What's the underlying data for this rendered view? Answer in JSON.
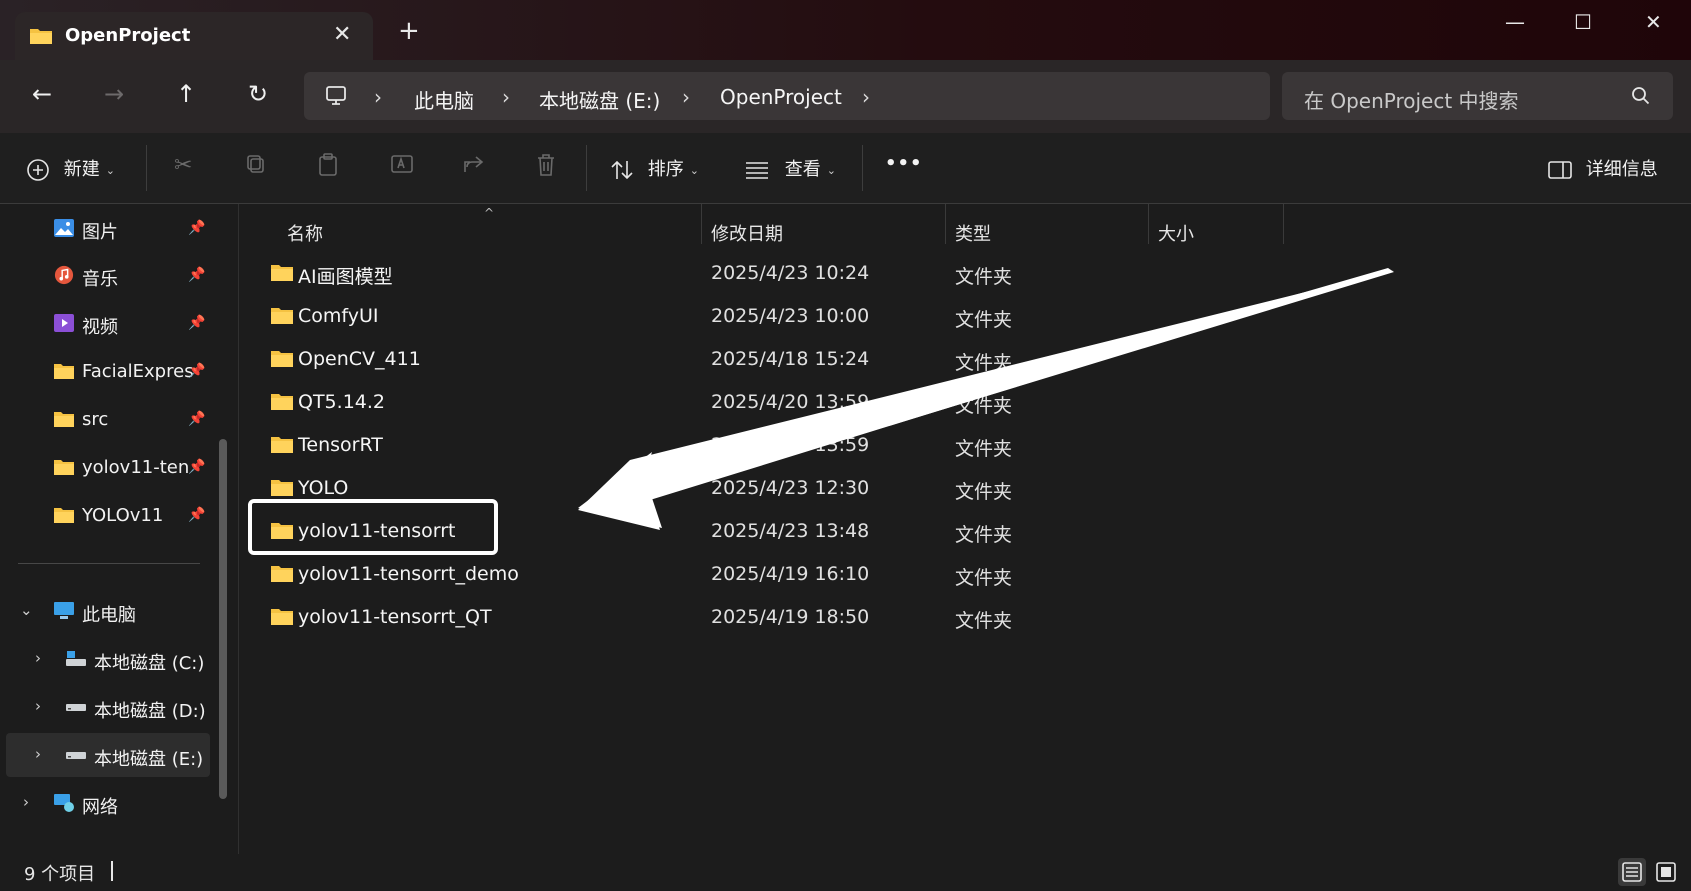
{
  "window": {
    "tab_title": "OpenProject",
    "tab_close": "✕",
    "new_tab": "+",
    "controls": {
      "minimize": "—",
      "maximize": "☐",
      "close": "✕"
    }
  },
  "nav": {
    "back": "←",
    "forward": "→",
    "up": "↑",
    "refresh": "↻",
    "breadcrumbs": [
      "此电脑",
      "本地磁盘 (E:)",
      "OpenProject"
    ],
    "separator": "›",
    "search_placeholder": "在 OpenProject 中搜索"
  },
  "toolbar": {
    "new_label": "新建",
    "sort_label": "排序",
    "view_label": "查看",
    "more_label": "•••",
    "details_label": "详细信息"
  },
  "sidebar": {
    "quick_access": [
      {
        "label": "图片",
        "icon": "pictures-icon"
      },
      {
        "label": "音乐",
        "icon": "music-icon"
      },
      {
        "label": "视频",
        "icon": "videos-icon"
      },
      {
        "label": "FacialExpres",
        "icon": "folder-icon"
      },
      {
        "label": "src",
        "icon": "folder-icon"
      },
      {
        "label": "yolov11-ten",
        "icon": "folder-icon"
      },
      {
        "label": "YOLOv11",
        "icon": "folder-icon"
      }
    ],
    "this_pc": "此电脑",
    "drives": [
      "本地磁盘 (C:)",
      "本地磁盘 (D:)",
      "本地磁盘 (E:)"
    ],
    "network": "网络"
  },
  "columns": {
    "name": "名称",
    "date": "修改日期",
    "type": "类型",
    "size": "大小"
  },
  "files": [
    {
      "name": "AI画图模型",
      "date": "2025/4/23 10:24",
      "type": "文件夹"
    },
    {
      "name": "ComfyUI",
      "date": "2025/4/23 10:00",
      "type": "文件夹"
    },
    {
      "name": "OpenCV_411",
      "date": "2025/4/18 15:24",
      "type": "文件夹"
    },
    {
      "name": "QT5.14.2",
      "date": "2025/4/20 13:59",
      "type": "文件夹"
    },
    {
      "name": "TensorRT",
      "date": "2025/4/20 13:59",
      "type": "文件夹"
    },
    {
      "name": "YOLO",
      "date": "2025/4/23 12:30",
      "type": "文件夹"
    },
    {
      "name": "yolov11-tensorrt",
      "date": "2025/4/23 13:48",
      "type": "文件夹"
    },
    {
      "name": "yolov11-tensorrt_demo",
      "date": "2025/4/19 16:10",
      "type": "文件夹"
    },
    {
      "name": "yolov11-tensorrt_QT",
      "date": "2025/4/19 18:50",
      "type": "文件夹"
    }
  ],
  "status": {
    "item_count": "9 个项目"
  },
  "colors": {
    "folder": "#f5c242",
    "accent": "#4aa3e8",
    "highlight_box": "#ffffff"
  }
}
